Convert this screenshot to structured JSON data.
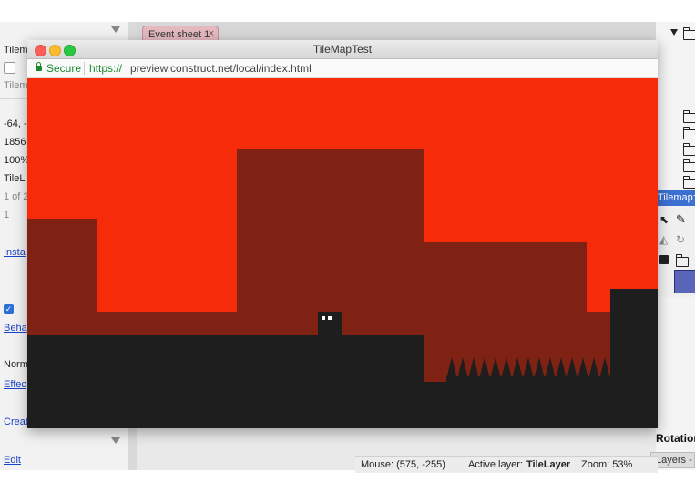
{
  "editor": {
    "left_panel": {
      "rows": [
        "Tilem",
        "Tilem",
        "-64, -",
        "1856",
        "100%",
        "TileL",
        "1 of 2",
        "1",
        "Insta",
        "Beha",
        "Norm",
        "Effec",
        "Creat",
        "Edit"
      ]
    },
    "tab": {
      "label": "Event sheet 1",
      "close": "×"
    },
    "right_panel": {
      "tilemap_title": "Tilemap:",
      "rotation_label": "Rotation",
      "layers_tab": "Layers -"
    },
    "status_bar": {
      "mouse": "Mouse: (575, -255)",
      "active_layer_label": "Active layer:",
      "active_layer_value": "TileLayer",
      "zoom": "Zoom: 53%"
    }
  },
  "browser": {
    "title": "TileMapTest",
    "secure_label": "Secure",
    "url_scheme": "https://",
    "url_rest": "preview.construct.net/local/index.html"
  },
  "colors": {
    "sky": "#f62b0a",
    "background_tiles": "#7f2213",
    "ground": "#1e1e1e",
    "close_btn": "#fc5f57",
    "min_btn": "#fdbc2e",
    "max_btn": "#28c840",
    "secure_green": "#1a8a2e"
  }
}
